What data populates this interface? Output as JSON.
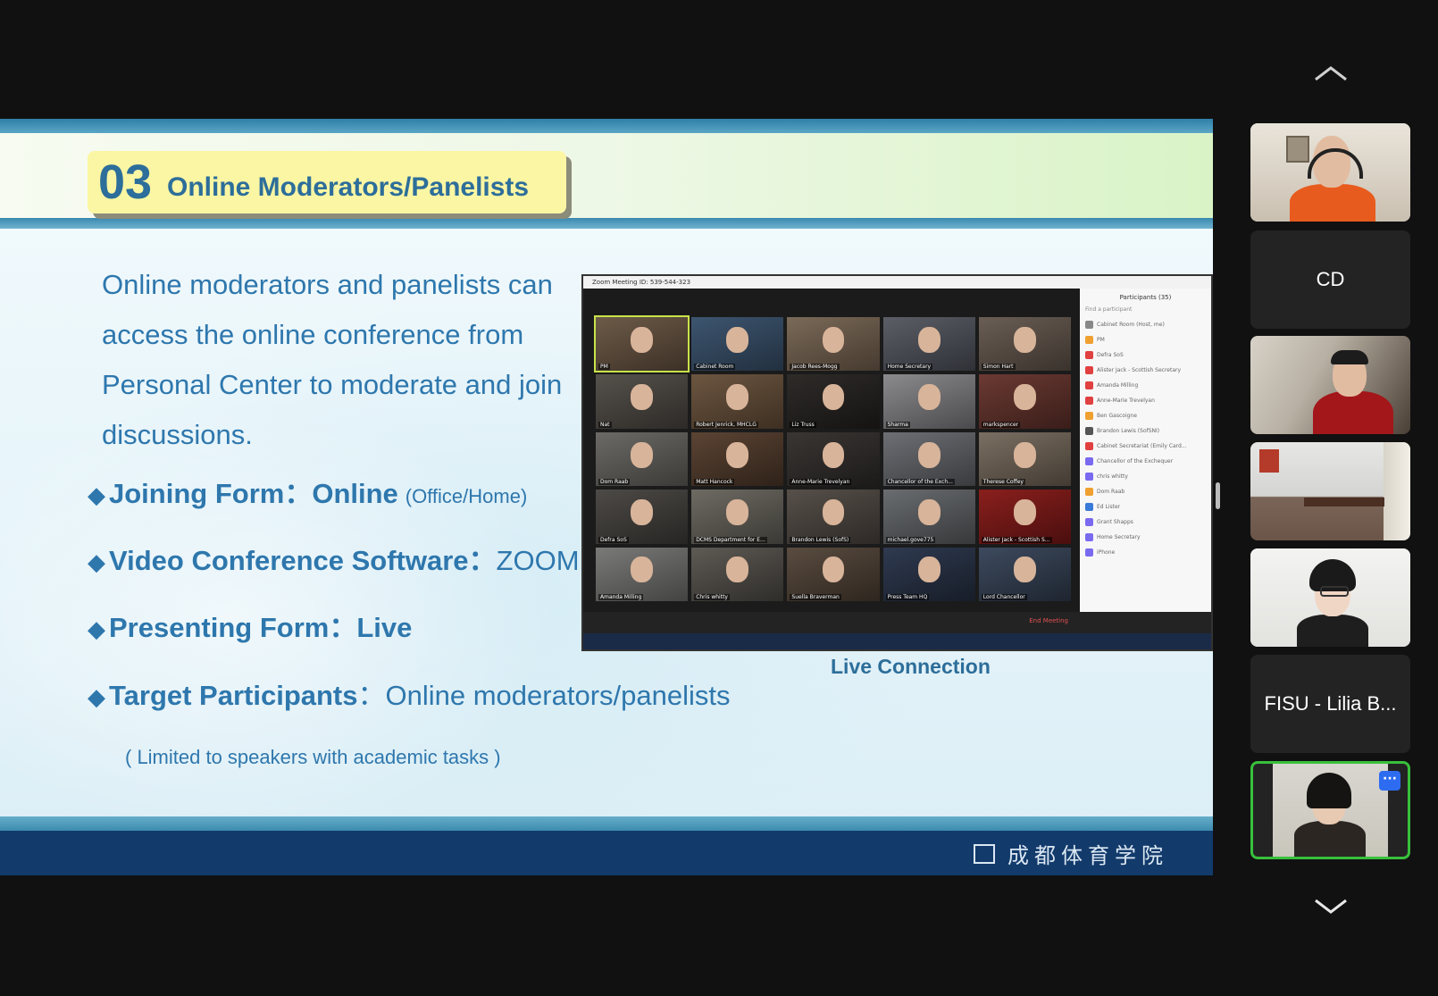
{
  "slide": {
    "title_number": "03",
    "title_text": "Online Moderators/Panelists",
    "intro": "Online moderators and panelists can access the online conference from Personal Center to moderate and join discussions.",
    "bullets": [
      {
        "label": "Joining Form",
        "sep": "：",
        "value": "Online",
        "note": "(Office/Home)"
      },
      {
        "label": "Video Conference Software",
        "sep": "：",
        "value": "ZOOM",
        "note": ""
      },
      {
        "label": "Presenting Form",
        "sep": "：",
        "value": "Live",
        "note": ""
      },
      {
        "label": "Target Participants",
        "sep": "：",
        "value": "Online moderators/panelists",
        "note": ""
      }
    ],
    "limit_note": "( Limited to speakers with academic tasks )",
    "image_caption": "Live Connection",
    "footer_text": "成都体育学院"
  },
  "embedded_zoom": {
    "window_title": "Zoom Meeting ID: 539-544-323",
    "participants_title": "Participants (35)",
    "find_placeholder": "Find a participant",
    "end_meeting": "End Meeting",
    "tiles": [
      "PM",
      "Cabinet Room",
      "Jacob Rees-Mogg",
      "Home Secretary",
      "Simon Hart",
      "Nat",
      "Robert Jenrick, MHCLG",
      "Liz Truss",
      "Sharma",
      "markspencer",
      "Dom Raab",
      "Matt Hancock",
      "Anne-Marie Trevelyan",
      "Chancellor of the Exch...",
      "Therese Coffey",
      "Defra SoS",
      "DCMS Department for E...",
      "Brandon Lewis (SofS)",
      "michael.gove775",
      "Alister Jack - Scottish S...",
      "Amanda Milling",
      "Chris whitty",
      "Suella Braverman",
      "Press Team HQ",
      "Lord Chancellor"
    ],
    "side_list": [
      "Cabinet Room (Host, me)",
      "PM",
      "Defra SoS",
      "Alister Jack - Scottish Secretary",
      "Amanda Milling",
      "Anne-Marie Trevelyan",
      "Ben Gascoigne",
      "Brandon Lewis (SofSNI)",
      "Cabinet Secretariat (Emily Card...",
      "Chancellor of the Exchequer",
      "chris whitty",
      "Dom Raab",
      "Ed Lister",
      "Grant Shapps",
      "Home Secretary",
      "iPhone"
    ]
  },
  "participant_strip": {
    "tiles": [
      {
        "type": "video",
        "name": ""
      },
      {
        "type": "name",
        "name": "CD"
      },
      {
        "type": "video",
        "name": ""
      },
      {
        "type": "video",
        "name": ""
      },
      {
        "type": "video",
        "name": ""
      },
      {
        "type": "name",
        "name": "FISU - Lilia B..."
      },
      {
        "type": "video",
        "name": ""
      }
    ],
    "more_label": "···"
  },
  "colors": {
    "slide_blue": "#2e77ad",
    "title_yellow": "#fbf6a3",
    "footer_navy": "#123a6b",
    "active_speaker": "#38c03c",
    "more_button": "#2d6cf0"
  }
}
